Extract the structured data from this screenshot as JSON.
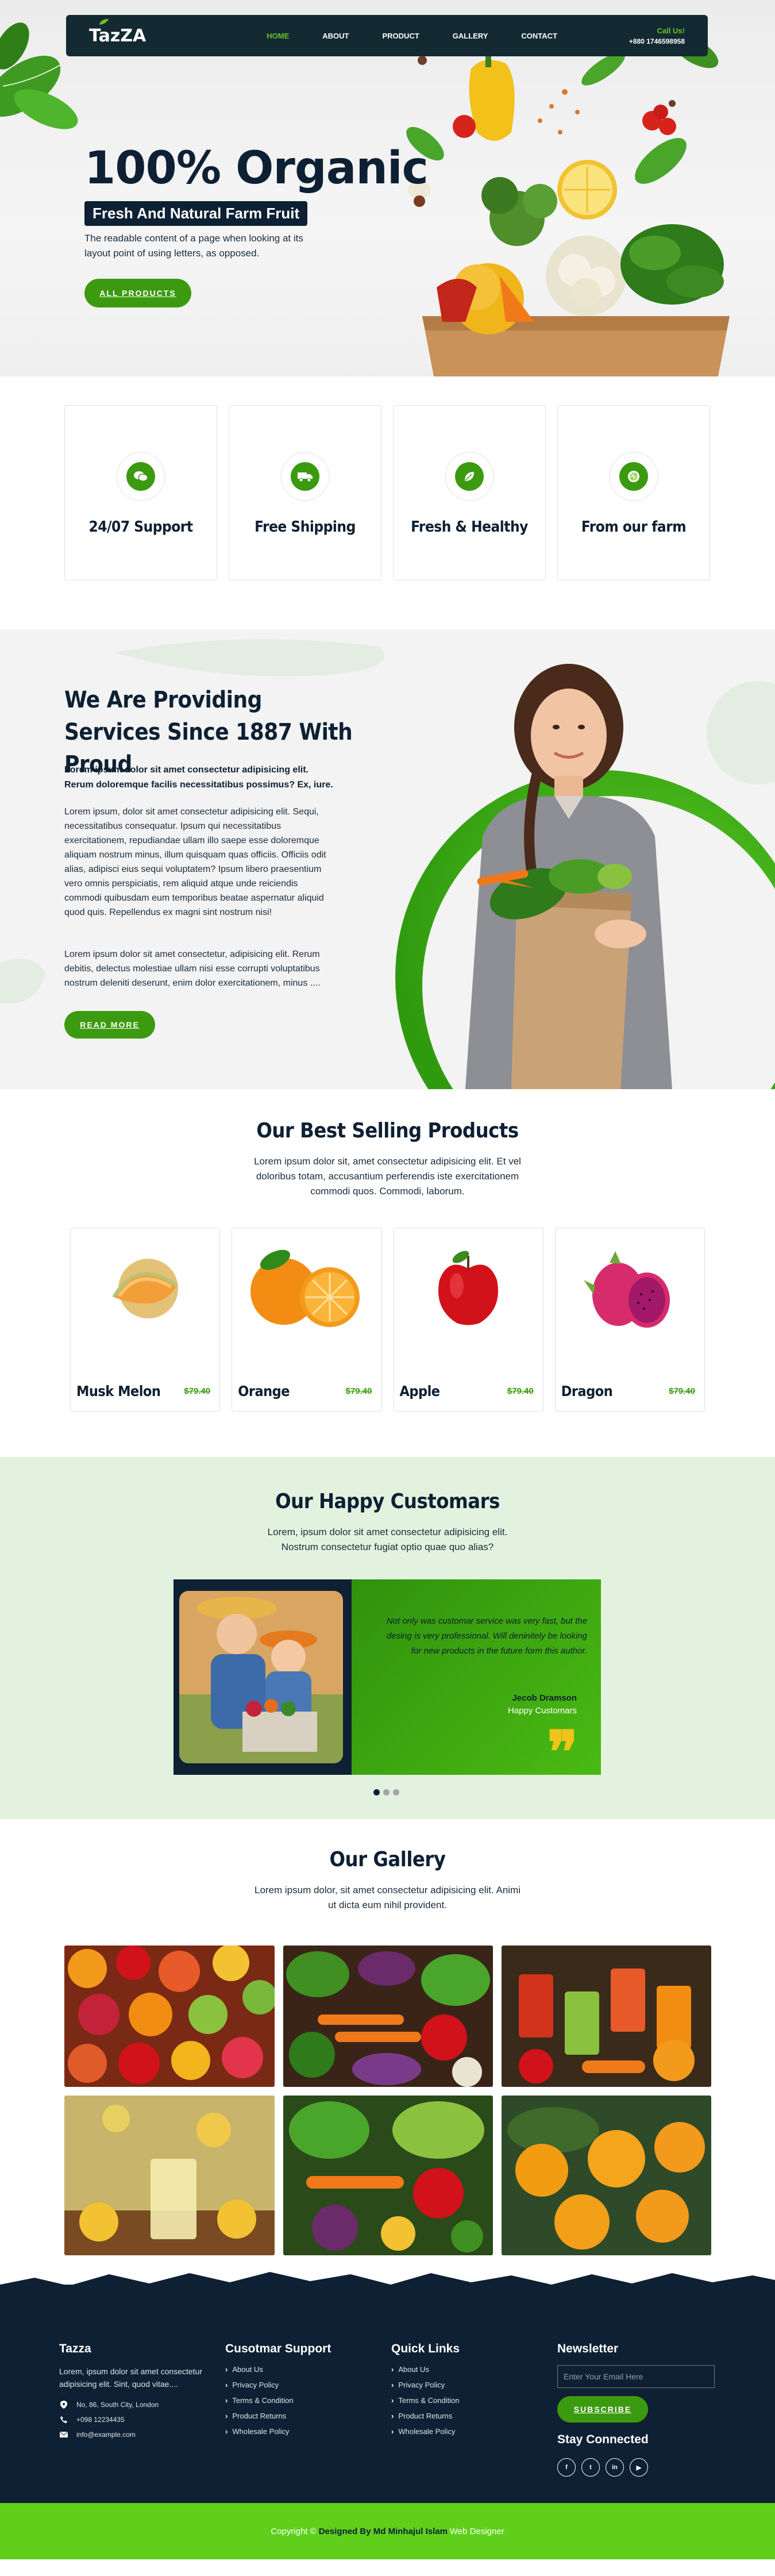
{
  "nav": {
    "logo": "TazZA",
    "links": [
      "HOME",
      "ABOUT",
      "PRODUCT",
      "GALLERY",
      "CONTACT"
    ],
    "call_label": "Call Us!",
    "call_number": "+880 1746598958"
  },
  "hero": {
    "title": "100% Organic",
    "subtitle": "Fresh And Natural Farm Fruit",
    "description": "The readable content of a page when looking at its layout point of using letters, as opposed.",
    "button": "ALL PRODUCTS"
  },
  "features": [
    {
      "title": "24/07 Support",
      "icon": "support-chat-icon"
    },
    {
      "title": "Free Shipping",
      "icon": "delivery-truck-icon"
    },
    {
      "title": "Fresh & Healthy",
      "icon": "leaf-icon"
    },
    {
      "title": "From our farm",
      "icon": "lime-icon"
    }
  ],
  "about": {
    "title": "We Are Providing Services Since 1887 With Proud",
    "bold_text": "Lorem ipsum dolor sit amet consectetur adipisicing elit. Rerum doloremque facilis necessitatibus possimus? Ex, iure.",
    "paragraph1": "Lorem ipsum, dolor sit amet consectetur adipisicing elit. Sequi, necessitatibus consequatur. Ipsum qui necessitatibus exercitationem, repudiandae ullam illo saepe esse doloremque aliquam nostrum minus, illum quisquam quas officiis. Officiis odit alias, adipisci eius sequi voluptatem? Ipsum libero praesentium vero omnis perspiciatis, rem aliquid atque unde reiciendis commodi quibusdam eum temporibus beatae aspernatur aliquid quod quis. Repellendus ex magni sint nostrum nisi!",
    "paragraph2": "Lorem ipsum dolor sit amet consectetur, adipisicing elit. Rerum debitis, delectus molestiae ullam nisi esse corrupti voluptatibus nostrum deleniti deserunt, enim dolor exercitationem, minus ....",
    "button": "READ MORE"
  },
  "products": {
    "title": "Our Best Selling Products",
    "description": "Lorem ipsum dolor sit, amet consectetur adipisicing elit. Et vel doloribus totam, accusantium perferendis iste exercitationem commodi quos. Commodi, laborum.",
    "items": [
      {
        "name": "Musk Melon",
        "price": "$79.40"
      },
      {
        "name": "Orange",
        "price": "$79.40"
      },
      {
        "name": "Apple",
        "price": "$79.40"
      },
      {
        "name": "Dragon",
        "price": "$79.40"
      }
    ]
  },
  "testimonials": {
    "title": "Our Happy Customars",
    "description": "Lorem, ipsum dolor sit amet consectetur adipisicing elit. Nostrum consectetur fugiat optio quae quo alias?",
    "quote": "Not only was customar service was very fast, but the desing is very professional. Will deninitely be looking for new products in the future form this author.",
    "name": "Jecob Dramson",
    "role": "Happy Customars",
    "slides": 3,
    "active_slide": 1
  },
  "gallery": {
    "title": "Our Gallery",
    "description": "Lorem ipsum dolor, sit amet consectetur adipisicing elit. Animi ut dicta eum nihil provident."
  },
  "footer": {
    "brand": "Tazza",
    "about": "Lorem, ipsum dolor sit amet consectetur adipisicing elit. Sint, quod vitae....",
    "address": "No, 86, South City, London",
    "phone": "+098 12234435",
    "email": "info@example.com",
    "support_title": "Cusotmar Support",
    "support_links": [
      "About Us",
      "Privacy Policy",
      "Terms & Condition",
      "Product Returns",
      "Wholesale Policy"
    ],
    "quick_title": "Quick Links",
    "quick_links": [
      "About Us",
      "Privacy Policy",
      "Terms & Condition",
      "Product Returns",
      "Wholesale Policy"
    ],
    "newsletter_title": "Newsletter",
    "newsletter_placeholder": "Enter Your Email Here",
    "subscribe": "SUBSCRIBE",
    "stay_connected": "Stay Connected",
    "socials": [
      {
        "label": "f",
        "icon": "facebook-icon"
      },
      {
        "label": "t",
        "icon": "twitter-icon"
      },
      {
        "label": "in",
        "icon": "linkedin-icon"
      },
      {
        "label": "▶",
        "icon": "youtube-icon"
      }
    ]
  },
  "copyright": {
    "prefix": "Copyright ©",
    "designer": "Designed By Md Minhajul Islam",
    "suffix": "Web Designer"
  },
  "colors": {
    "primary_green": "#3c9a10",
    "bright_green": "#5fcf1b",
    "navy": "#0e2033",
    "testimonial_bg": "#e3f2df",
    "accent_yellow": "#f0c419"
  }
}
